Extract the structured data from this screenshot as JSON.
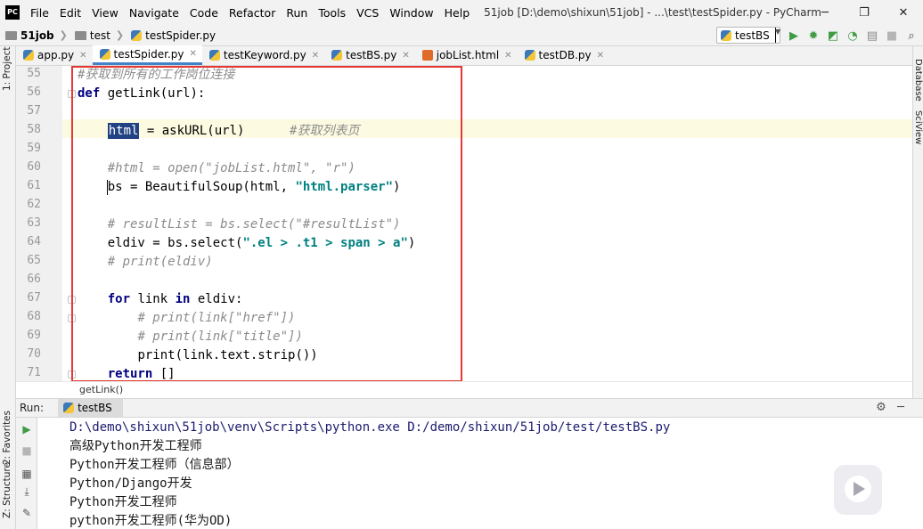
{
  "menubar": {
    "logo": "PC",
    "items": [
      "File",
      "Edit",
      "View",
      "Navigate",
      "Code",
      "Refactor",
      "Run",
      "Tools",
      "VCS",
      "Window",
      "Help"
    ],
    "window_title": "51job [D:\\demo\\shixun\\51job] - ...\\test\\testSpider.py - PyCharm",
    "minimize": "─",
    "restore": "❐",
    "close": "✕"
  },
  "navbar": {
    "project": "51job",
    "folder": "test",
    "file": "testSpider.py",
    "run_config": "testBS"
  },
  "left_strip": {
    "project": "1: Project",
    "favorites": "2: Favorites",
    "structure": "Z: Structure"
  },
  "right_strip": {
    "database": "Database",
    "sciview": "SciView"
  },
  "tabs": [
    {
      "label": "app.py",
      "icon": "python-file-icon"
    },
    {
      "label": "testSpider.py",
      "icon": "python-file-icon",
      "active": true
    },
    {
      "label": "testKeyword.py",
      "icon": "python-file-icon"
    },
    {
      "label": "testBS.py",
      "icon": "python-file-icon"
    },
    {
      "label": "jobList.html",
      "icon": "html-file-icon"
    },
    {
      "label": "testDB.py",
      "icon": "python-file-icon"
    }
  ],
  "editor": {
    "line_numbers": [
      "55",
      "56",
      "57",
      "58",
      "59",
      "60",
      "61",
      "62",
      "63",
      "64",
      "65",
      "66",
      "67",
      "68",
      "69",
      "70",
      "71"
    ],
    "lines": {
      "l55_comment": "#获取到所有的工作岗位连接",
      "l56_kw": "def",
      "l56_rest": " getLink(url):",
      "l58_sel": "html",
      "l58_rest": " = askURL(url)      ",
      "l58_comment": "#获取列表页",
      "l60_comment": "#html = open(\"jobList.html\", \"r\")",
      "l61_a": "bs = BeautifulSoup(html, ",
      "l61_str": "\"html.parser\"",
      "l61_b": ")",
      "l63_comment": "# resultList = bs.select(\"#resultList\")",
      "l64_a": "eldiv = bs.select(",
      "l64_str": "\".el > .t1 > span > a\"",
      "l64_b": ")",
      "l65_comment": "# print(eldiv)",
      "l67_kw1": "for",
      "l67_mid": " link ",
      "l67_kw2": "in",
      "l67_rest": " eldiv:",
      "l68_comment": "# print(link[\"href\"])",
      "l69_comment": "# print(link[\"title\"])",
      "l70": "print(link.text.strip())",
      "l71_kw": "return",
      "l71_rest": " []"
    },
    "breadcrumb": "getLink()"
  },
  "run": {
    "label": "Run:",
    "tab": "testBS",
    "console": [
      "D:\\demo\\shixun\\51job\\venv\\Scripts\\python.exe D:/demo/shixun/51job/test/testBS.py",
      "高级Python开发工程师",
      "Python开发工程师（信息部）",
      "Python/Django开发",
      "Python开发工程师",
      "python开发工程师(华为OD)"
    ]
  },
  "colors": {
    "keyword": "#000080",
    "comment": "#8c8c8c",
    "string": "#008080",
    "selection": "#214283",
    "highlight_box": "#e53935",
    "current_line": "#fcfae1"
  }
}
